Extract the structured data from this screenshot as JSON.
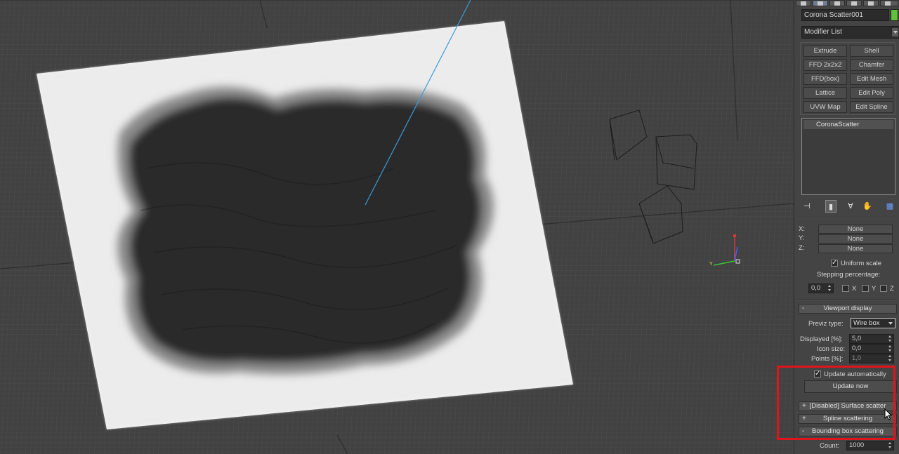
{
  "panel": {
    "object_name": "Corona Scatter001",
    "object_color": "#5fc33a",
    "modifier_list": "Modifier List",
    "modifier_buttons": [
      "Extrude",
      "Shell",
      "FFD 2x2x2",
      "Chamfer",
      "FFD(box)",
      "Edit Mesh",
      "Lattice",
      "Edit Poly",
      "UVW Map",
      "Edit Spline"
    ],
    "stack_items": [
      "CoronaScatter"
    ],
    "scale": {
      "x_label": "X:",
      "y_label": "Y:",
      "z_label": "Z:",
      "x_value": "None",
      "y_value": "None",
      "z_value": "None",
      "uniform_scale": "Uniform scale",
      "stepping_label": "Stepping percentage:",
      "stepping_value": "0,0",
      "x_chk": "X",
      "y_chk": "Y",
      "z_chk": "Z"
    },
    "viewport_display": {
      "title": "Viewport display",
      "collapse_symbol": "-",
      "previz_label": "Previz type:",
      "previz_value": "Wire box",
      "displayed_label": "Displayed [%]:",
      "displayed_value": "5,0",
      "icon_size_label": "Icon size:",
      "icon_size_value": "0,0",
      "points_label": "Points [%]:",
      "points_value": "1,0",
      "update_auto_label": "Update automatically",
      "update_now_label": "Update now"
    },
    "rollouts": [
      {
        "symbol": "+",
        "label": "[Disabled] Surface scatter"
      },
      {
        "symbol": "+",
        "label": "Spline scattering"
      },
      {
        "symbol": "-",
        "label": "Bounding box scattering"
      }
    ],
    "count_label": "Count:",
    "count_value": "1000"
  },
  "colors": {
    "highlight": "#e0141b",
    "viewport_bg": "#424242",
    "panel_bg": "#444444",
    "ray_line": "#3a9bdc"
  }
}
